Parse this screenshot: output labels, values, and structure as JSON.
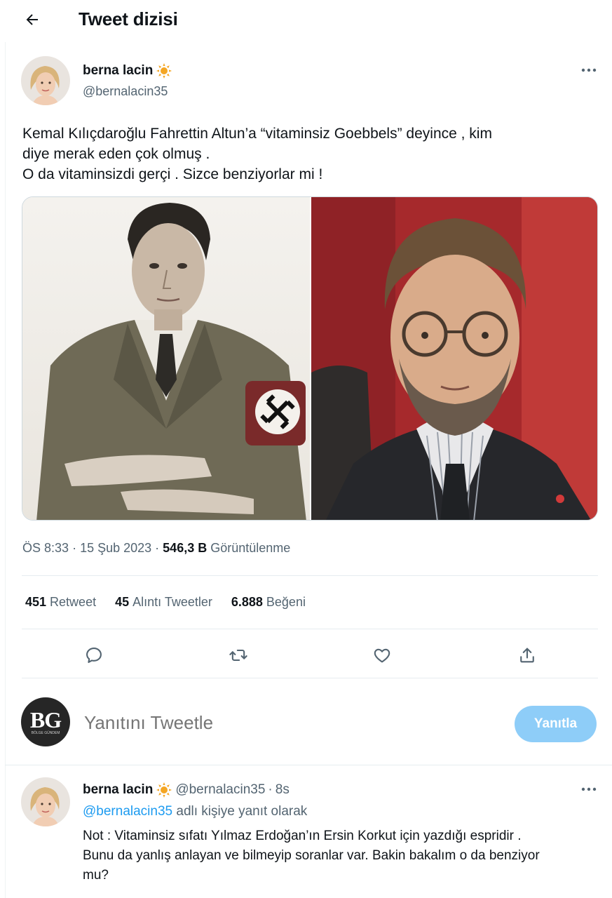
{
  "header": {
    "title": "Tweet dizisi"
  },
  "tweet": {
    "author_name": "berna lacin",
    "handle": "@bernalacin35",
    "text_lines": [
      "Kemal Kılıçdaroğlu Fahrettin Altun’a “vitaminsiz Goebbels” deyince , kim",
      "diye merak eden çok olmuş .",
      "O da vitaminsizdi gerçi . Sizce benziyorlar mi !"
    ],
    "time": "ÖS 8:33",
    "date": "15 Şub 2023",
    "views_count": "546,3 B",
    "views_label": "Görüntülenme",
    "stats": {
      "retweets_count": "451",
      "retweets_label": "Retweet",
      "quotes_count": "45",
      "quotes_label": "Alıntı Tweetler",
      "likes_count": "6.888",
      "likes_label": "Beğeni"
    }
  },
  "reply_box": {
    "avatar_text": "BG",
    "avatar_subtext": "BÖLGE GÜNDEM",
    "placeholder": "Yanıtını Tweetle",
    "button_label": "Yanıtla"
  },
  "reply": {
    "author_name": "berna lacin",
    "handle": "@bernalacin35",
    "time_ago": "8s",
    "replying_link": "@bernalacin35",
    "replying_suffix": "adlı kişiye yanıt olarak",
    "text_lines": [
      "Not : Vitaminsiz sıfatı Yılmaz Erdoğan’ın Ersin Korkut için yazdığı espridir .",
      "Bunu da yanlış anlayan ve bilmeyip soranlar var. Bakin bakalım o da benziyor",
      "mu?"
    ]
  },
  "colors": {
    "accent": "#1d9bf0",
    "reply_button": "#8ecdf8",
    "secondary_text": "#536471",
    "badge": "#f4a624"
  },
  "icons": [
    "back-arrow-icon",
    "verified-sun-badge-icon",
    "more-icon",
    "reply-icon",
    "retweet-icon",
    "like-icon",
    "share-icon"
  ]
}
